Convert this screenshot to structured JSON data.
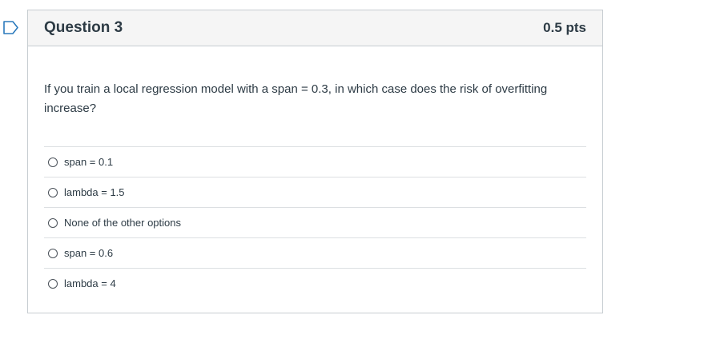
{
  "question": {
    "title": "Question 3",
    "points": "0.5 pts",
    "text": "If you train a local regression model with a span = 0.3, in which case does the risk of overfitting increase?",
    "answers": [
      {
        "label": "span = 0.1"
      },
      {
        "label": "lambda = 1.5"
      },
      {
        "label": "None of the other options"
      },
      {
        "label": "span = 0.6"
      },
      {
        "label": "lambda = 4"
      }
    ]
  },
  "colors": {
    "accent": "#2b7abc",
    "border": "#c7cdd1",
    "header_bg": "#f5f5f5",
    "text": "#2d3b45"
  },
  "icons": {
    "flag": "bookmark-flag-icon"
  }
}
